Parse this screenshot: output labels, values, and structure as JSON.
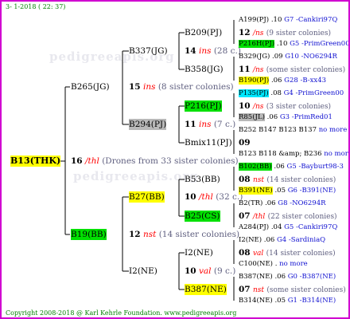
{
  "header": "3- 1-2018 ( 22: 37)",
  "watermark": "pedigreeapis.org",
  "footer": "Copyright 2008-2018 @ Karl Kehrle Foundation.   www.pedigreeapis.org",
  "root": {
    "id": "B13(THK)",
    "year": "16",
    "breeder": "/thl",
    "drones": "(Drones from 33 sister colonies)"
  },
  "gen1": {
    "dam": "B265(JG)",
    "dam_year": "15",
    "dam_breeder": "ins",
    "dam_note": "(8 sister colonies)",
    "sire": "B19(BB)",
    "sire_year": "12",
    "sire_breeder": "nst",
    "sire_note": "(14 sister colonies)"
  },
  "gen2": [
    {
      "id": "B337(JG)",
      "year": "14",
      "breeder": "ins",
      "note": "(28 c.)"
    },
    {
      "id": "B294(PJ)",
      "year": "11",
      "breeder": "ins",
      "note": "(7 c.)"
    },
    {
      "id": "B27(BB)",
      "year": "10",
      "breeder": "/thl",
      "note": "(32 c.)"
    },
    {
      "id": "I2(NE)",
      "year": "10",
      "breeder": "val",
      "note": "(9 c.)"
    }
  ],
  "gen3": [
    {
      "id": "B209(PJ)",
      "year": "12",
      "breeder": "/ns",
      "note": "(9 sister colonies)"
    },
    {
      "id": "B358(JG)",
      "year": "11",
      "breeder": "/ns",
      "note": "(some sister colonies)"
    },
    {
      "id": "P216(PJ)",
      "year": "10",
      "breeder": "/ns",
      "note": "(3 sister colonies)"
    },
    {
      "id": "Bmix11(PJ)",
      "year": "09",
      "breeder": "",
      "note": ""
    },
    {
      "id": "B53(BB)",
      "year": "08",
      "breeder": "nst",
      "note": "(14 sister colonies)"
    },
    {
      "id": "B25(CS)",
      "year": "07",
      "breeder": "/thl",
      "note": "(22 sister colonies)"
    },
    {
      "id": "I2(NE)",
      "year": "08",
      "breeder": "val",
      "note": "(14 sister colonies)"
    },
    {
      "id": "B387(NE)",
      "year": "07",
      "breeder": "nst",
      "note": "(some sister colonies)"
    }
  ],
  "gen4": [
    {
      "id": "A199(PJ)",
      "year": ".10",
      "line": "G7 -Cankiri97Q"
    },
    {
      "id": "P216H(PJ)",
      "year": ".10",
      "line": "G5 -PrimGreen00"
    },
    {
      "id": "B329(JG)",
      "year": ".09",
      "line": "G10 -NO6294R"
    },
    {
      "id": "B190(PJ)",
      "year": ".06",
      "line": "G28 -B-xx43"
    },
    {
      "id": "P135(PJ)",
      "year": ".08",
      "line": "G4 -PrimGreen00"
    },
    {
      "id": "R85(JL)",
      "year": ".06",
      "line": "G3 -PrimRed01"
    },
    {
      "id": "B252 B147 B123 B137",
      "line": "no more"
    },
    {
      "id": "B123 B118 &amp; B236",
      "line": "no more"
    },
    {
      "id": "B102(BB)",
      "year": ".06",
      "line": "G5 -Bayburt98-3"
    },
    {
      "id": "B391(NE)",
      "year": ".05",
      "line": "G6 -B391(NE)"
    },
    {
      "id": "B2(TR)",
      "year": ".06",
      "line": "G8 -NO6294R"
    },
    {
      "id": "A284(PJ)",
      "year": ".04",
      "line": "G5 -Cankiri97Q"
    },
    {
      "id": "I2(NE)",
      "year": ".06",
      "line": "G4 -SardiniaQ"
    },
    {
      "id": "C100(NE)",
      "year": ".",
      "line": "no more"
    },
    {
      "id": "B387(NE)",
      "year": ".06",
      "line": "G0 -B387(NE)"
    },
    {
      "id": "B314(NE)",
      "year": ".05",
      "line": "G1 -B314(NE)"
    }
  ]
}
